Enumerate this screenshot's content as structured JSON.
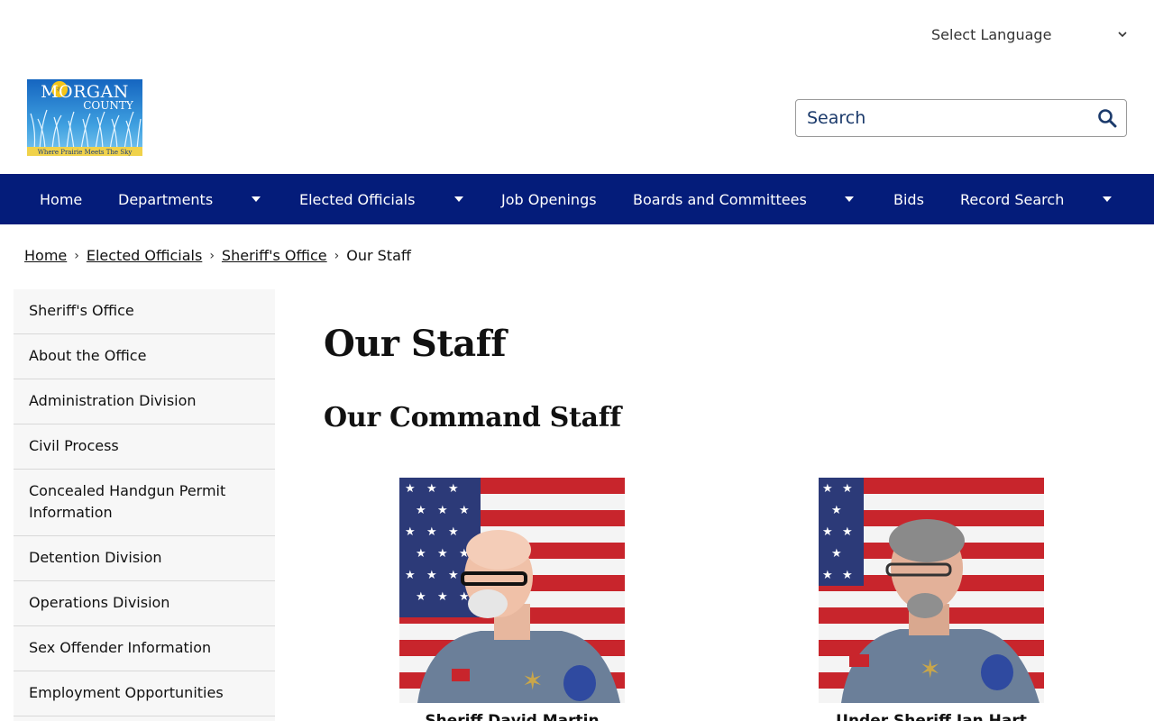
{
  "language": {
    "label": "Select Language"
  },
  "logo": {
    "title": "MORGAN",
    "subtitle": "COUNTY",
    "tagline": "Where Prairie Meets The Sky"
  },
  "search": {
    "placeholder": "Search"
  },
  "nav": {
    "items": [
      "Home",
      "Departments",
      "Elected Officials",
      "Job Openings",
      "Boards and Committees",
      "Bids",
      "Record Search"
    ]
  },
  "breadcrumb": {
    "items": [
      "Home",
      "Elected Officials",
      "Sheriff's Office"
    ],
    "current": "Our Staff"
  },
  "sidebar": {
    "items": [
      "Sheriff's Office",
      "About the Office",
      "Administration Division",
      "Civil Process",
      "Concealed Handgun Permit Information",
      "Detention Division",
      "Operations Division",
      "Sex Offender Information",
      "Employment Opportunities"
    ]
  },
  "main": {
    "title": "Our Staff",
    "section_title": "Our Command Staff",
    "staff": [
      {
        "name": "Sheriff David Martin"
      },
      {
        "name": "Under Sheriff Ian Hart"
      }
    ]
  },
  "colors": {
    "nav_bg": "#041c7a",
    "search_icon": "#1b3a6b"
  }
}
